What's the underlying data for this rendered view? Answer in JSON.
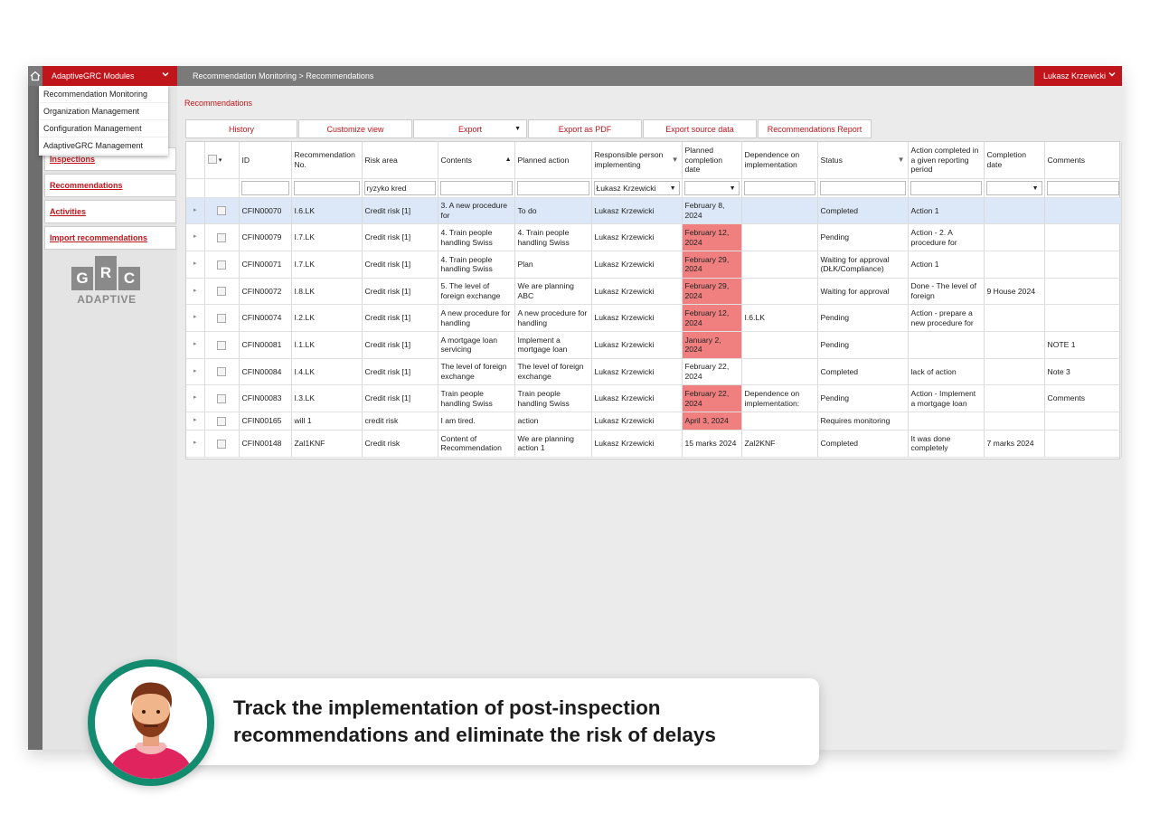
{
  "topbar": {
    "modules_label": "AdaptiveGRC Modules",
    "breadcrumb": "Recommendation Monitoring > Recommendations",
    "user_name": "Lukasz Krzewicki"
  },
  "modules_menu": [
    "Recommendation Monitoring",
    "Organization Management",
    "Configuration Management",
    "AdaptiveGRC Management"
  ],
  "sidebar": {
    "items": [
      "Inspections",
      "Recommendations",
      "Activities",
      "Import recommendations"
    ],
    "logo": {
      "letters": [
        "G",
        "R",
        "C"
      ],
      "word": "ADAPTIVE"
    }
  },
  "main": {
    "title": "Recommendations",
    "toolbar": [
      "History",
      "Customize view",
      "Export",
      "Export as PDF",
      "Export source data",
      "Recommendations Report"
    ]
  },
  "grid": {
    "columns": [
      "ID",
      "Recommendation No.",
      "Risk area",
      "Contents",
      "Planned action",
      "Responsible person implementing",
      "Planned completion date",
      "Dependence on implementation",
      "Status",
      "Action completed in a given reporting period",
      "Completion date",
      "Comments"
    ],
    "filters": {
      "risk_area": "ryzyko kred",
      "responsible": "Łukasz Krzewicki"
    },
    "rows": [
      {
        "id": "CFIN00070",
        "no": "I.6.LK",
        "risk": "Credit risk [1]",
        "contents": "3. A new procedure for",
        "planned": "To do",
        "resp": "Lukasz Krzewicki",
        "date": "February 8, 2024",
        "dep": "",
        "status": "Completed",
        "action": "Action 1",
        "completion": "",
        "comments": ""
      },
      {
        "id": "CFIN00079",
        "no": "I.7.LK",
        "risk": "Credit risk [1]",
        "contents": "4. Train people handling Swiss",
        "planned": "4. Train people handling Swiss",
        "resp": "Lukasz Krzewicki",
        "date": "February 12, 2024",
        "dep": "",
        "status": "Pending",
        "action": "Action - 2. A procedure for",
        "completion": "",
        "comments": ""
      },
      {
        "id": "CFIN00071",
        "no": "I.7.LK",
        "risk": "Credit risk [1]",
        "contents": "4. Train people handling Swiss",
        "planned": "Plan",
        "resp": "Lukasz Krzewicki",
        "date": "February 29, 2024",
        "dep": "",
        "status": "Waiting for approval (DŁK/Compliance)",
        "action": "Action 1",
        "completion": "",
        "comments": ""
      },
      {
        "id": "CFIN00072",
        "no": "I.8.LK",
        "risk": "Credit risk [1]",
        "contents": "5. The level of foreign exchange",
        "planned": "We are planning ABC",
        "resp": "Lukasz Krzewicki",
        "date": "February 29, 2024",
        "dep": "",
        "status": "Waiting for approval",
        "action": "Done - The level of foreign",
        "completion": "9 House 2024",
        "comments": ""
      },
      {
        "id": "CFIN00074",
        "no": "I.2.LK",
        "risk": "Credit risk [1]",
        "contents": "A new procedure for handling",
        "planned": "A new procedure for handling",
        "resp": "Lukasz Krzewicki",
        "date": "February 12, 2024",
        "dep": "I.6.LK",
        "status": "Pending",
        "action": "Action - prepare a new procedure for",
        "completion": "",
        "comments": ""
      },
      {
        "id": "CFIN00081",
        "no": "I.1.LK",
        "risk": "Credit risk [1]",
        "contents": "A mortgage loan servicing",
        "planned": "Implement a mortgage loan",
        "resp": "Lukasz Krzewicki",
        "date": "January 2, 2024",
        "dep": "",
        "status": "Pending",
        "action": "",
        "completion": "",
        "comments": "NOTE 1"
      },
      {
        "id": "CFIN00084",
        "no": "I.4.LK",
        "risk": "Credit risk [1]",
        "contents": "The level of foreign exchange",
        "planned": "The level of foreign exchange",
        "resp": "Lukasz Krzewicki",
        "date": "February 22, 2024",
        "dep": "",
        "status": "Completed",
        "action": "lack of action",
        "completion": "",
        "comments": "Note 3"
      },
      {
        "id": "CFIN00083",
        "no": "I.3.LK",
        "risk": "Credit risk [1]",
        "contents": "Train people handling Swiss",
        "planned": "Train people handling Swiss",
        "resp": "Lukasz Krzewicki",
        "date": "February 22, 2024",
        "dep": "Dependence on implementation:",
        "status": "Pending",
        "action": "Action - Implement a mortgage loan",
        "completion": "",
        "comments": "Comments"
      },
      {
        "id": "CFIN00165",
        "no": "will 1",
        "risk": "credit risk",
        "contents": "I am tired.",
        "planned": "action",
        "resp": "Lukasz Krzewicki",
        "date": "April 3, 2024",
        "dep": "",
        "status": "Requires monitoring",
        "action": "",
        "completion": "",
        "comments": ""
      },
      {
        "id": "CFIN00148",
        "no": "Zal1KNF",
        "risk": "Credit risk",
        "contents": "Content of Recommendation",
        "planned": "We are planning action 1",
        "resp": "Lukasz Krzewicki",
        "date": "15 marks 2024",
        "dep": "Zal2KNF",
        "status": "Completed",
        "action": "It was done completely",
        "completion": "7 marks 2024",
        "comments": ""
      }
    ],
    "overdue_color": "#f08080",
    "selected_row_color": "#dce8f7"
  },
  "caption": "Track the implementation of post-inspection recommendations and eliminate the risk of delays",
  "colors": {
    "brand_red": "#c0151b",
    "avatar_ring": "#138b6e"
  }
}
